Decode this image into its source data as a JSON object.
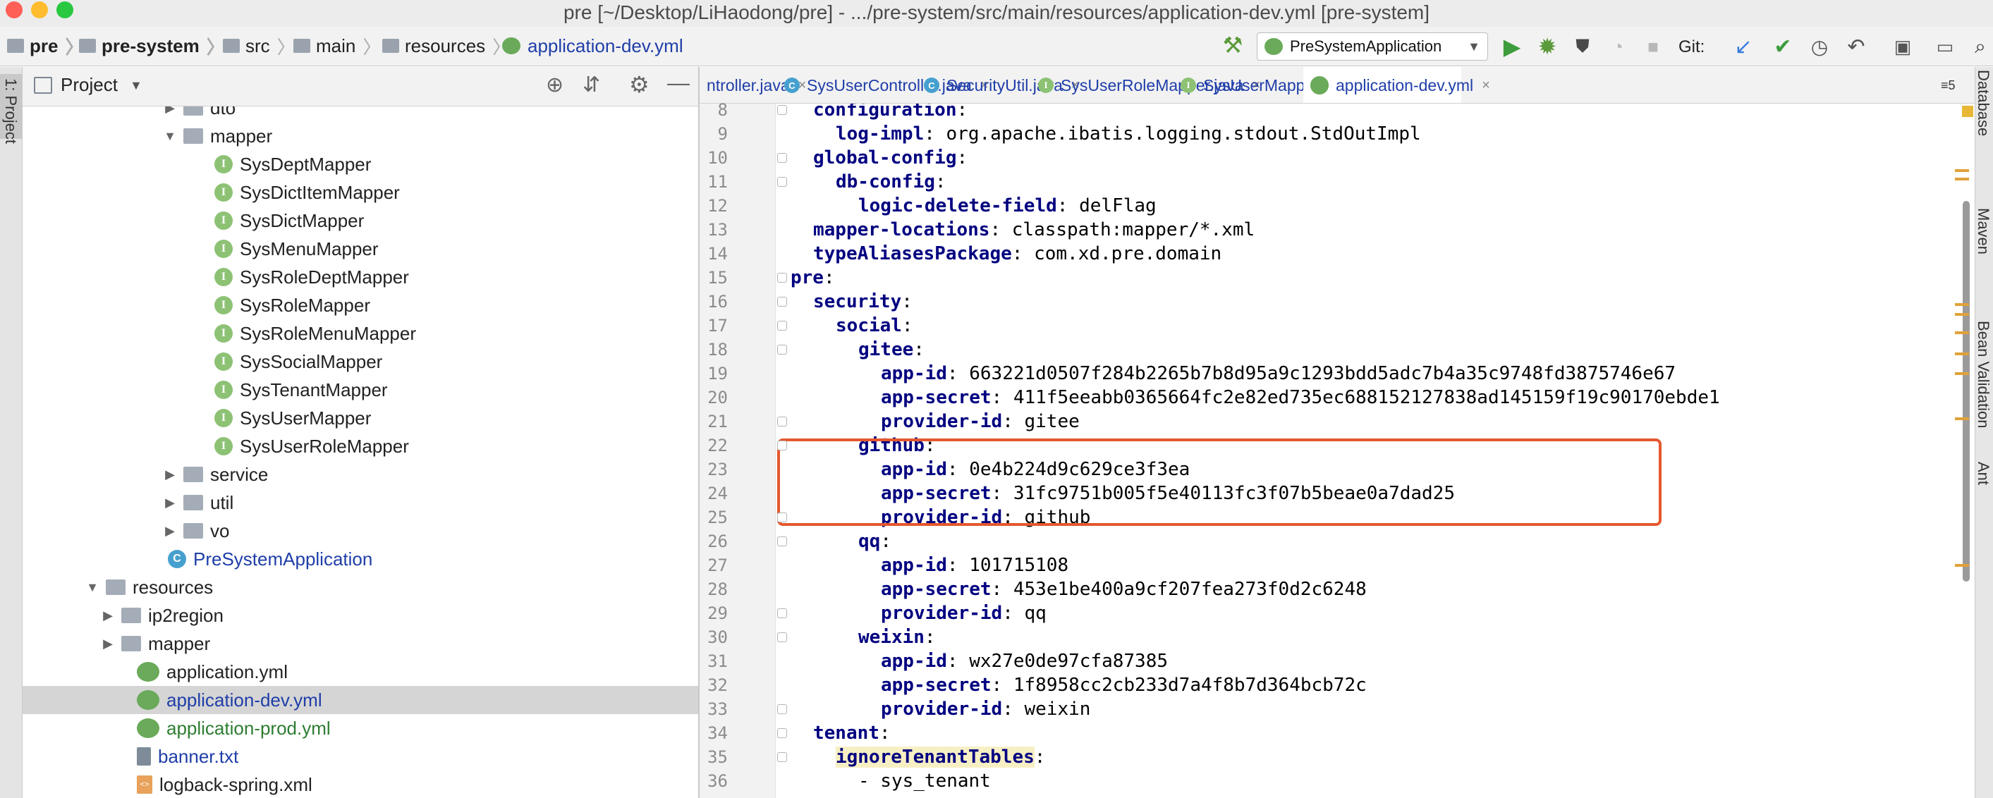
{
  "window": {
    "title": "pre [~/Desktop/LiHaodong/pre] - .../pre-system/src/main/resources/application-dev.yml [pre-system]"
  },
  "navbar": {
    "breadcrumbs": [
      "pre",
      "pre-system",
      "src",
      "main",
      "resources",
      "application-dev.yml"
    ],
    "run_config": "PreSystemApplication",
    "git_label": "Git:"
  },
  "left_strip": {
    "label": "1: Project"
  },
  "right_strip": {
    "labels": [
      "Database",
      "Maven",
      "Bean Validation",
      "Ant"
    ]
  },
  "project_panel": {
    "title": "Project",
    "tree": [
      {
        "label": "dto",
        "type": "folder",
        "depth": 9,
        "arrow": "right",
        "top": 0,
        "partial": true
      },
      {
        "label": "mapper",
        "type": "folder",
        "depth": 9,
        "arrow": "down"
      },
      {
        "label": "SysDeptMapper",
        "type": "interface",
        "depth": 11
      },
      {
        "label": "SysDictItemMapper",
        "type": "interface",
        "depth": 11
      },
      {
        "label": "SysDictMapper",
        "type": "interface",
        "depth": 11
      },
      {
        "label": "SysMenuMapper",
        "type": "interface",
        "depth": 11
      },
      {
        "label": "SysRoleDeptMapper",
        "type": "interface",
        "depth": 11
      },
      {
        "label": "SysRoleMapper",
        "type": "interface",
        "depth": 11
      },
      {
        "label": "SysRoleMenuMapper",
        "type": "interface",
        "depth": 11
      },
      {
        "label": "SysSocialMapper",
        "type": "interface",
        "depth": 11
      },
      {
        "label": "SysTenantMapper",
        "type": "interface",
        "depth": 11
      },
      {
        "label": "SysUserMapper",
        "type": "interface",
        "depth": 11
      },
      {
        "label": "SysUserRoleMapper",
        "type": "interface",
        "depth": 11
      },
      {
        "label": "service",
        "type": "folder",
        "depth": 9,
        "arrow": "right"
      },
      {
        "label": "util",
        "type": "folder",
        "depth": 9,
        "arrow": "right"
      },
      {
        "label": "vo",
        "type": "folder",
        "depth": 9,
        "arrow": "right"
      },
      {
        "label": "PreSystemApplication",
        "type": "class",
        "depth": 8
      },
      {
        "label": "resources",
        "type": "folder",
        "depth": 4,
        "arrow": "down"
      },
      {
        "label": "ip2region",
        "type": "folder",
        "depth": 5,
        "arrow": "right"
      },
      {
        "label": "mapper",
        "type": "folder",
        "depth": 5,
        "arrow": "right"
      },
      {
        "label": "application.yml",
        "type": "yml",
        "depth": 6
      },
      {
        "label": "application-dev.yml",
        "type": "yml",
        "depth": 6,
        "selected": true
      },
      {
        "label": "application-prod.yml",
        "type": "yml",
        "depth": 6
      },
      {
        "label": "banner.txt",
        "type": "txt",
        "depth": 6
      },
      {
        "label": "logback-spring.xml",
        "type": "xml",
        "depth": 6
      }
    ]
  },
  "editor": {
    "tabs": [
      {
        "label": "ntroller.java",
        "icon": "class"
      },
      {
        "label": "SysUserController.java",
        "icon": "class"
      },
      {
        "label": "SecurityUtil.java",
        "icon": "class"
      },
      {
        "label": "SysUserRoleMapper.java",
        "icon": "interface"
      },
      {
        "label": "SysUserMapper.java",
        "icon": "interface"
      },
      {
        "label": "application-dev.yml",
        "icon": "yml",
        "active": true
      }
    ],
    "tab_overflow": "≡5",
    "lines": [
      {
        "n": "8",
        "indent": 1,
        "key": "configuration",
        "sep": ":",
        "val": ""
      },
      {
        "n": "9",
        "indent": 2,
        "key": "log-impl",
        "sep": ": ",
        "val": "org.apache.ibatis.logging.stdout.StdOutImpl"
      },
      {
        "n": "10",
        "indent": 1,
        "key": "global-config",
        "sep": ":",
        "val": ""
      },
      {
        "n": "11",
        "indent": 2,
        "key": "db-config",
        "sep": ":",
        "val": ""
      },
      {
        "n": "12",
        "indent": 3,
        "key": "logic-delete-field",
        "sep": ": ",
        "val": "delFlag"
      },
      {
        "n": "13",
        "indent": 1,
        "key": "mapper-locations",
        "sep": ": ",
        "val": "classpath:mapper/*.xml"
      },
      {
        "n": "14",
        "indent": 1,
        "key": "typeAliasesPackage",
        "sep": ": ",
        "val": "com.xd.pre.domain"
      },
      {
        "n": "15",
        "indent": 0,
        "key": "pre",
        "sep": ":",
        "val": ""
      },
      {
        "n": "16",
        "indent": 1,
        "key": "security",
        "sep": ":",
        "val": ""
      },
      {
        "n": "17",
        "indent": 2,
        "key": "social",
        "sep": ":",
        "val": ""
      },
      {
        "n": "18",
        "indent": 3,
        "key": "gitee",
        "sep": ":",
        "val": ""
      },
      {
        "n": "19",
        "indent": 4,
        "key": "app-id",
        "sep": ": ",
        "val": "663221d0507f284b2265b7b8d95a9c1293bdd5adc7b4a35c9748fd3875746e67"
      },
      {
        "n": "20",
        "indent": 4,
        "key": "app-secret",
        "sep": ": ",
        "val": "411f5eeabb0365664fc2e82ed735ec688152127838ad145159f19c90170ebde1"
      },
      {
        "n": "21",
        "indent": 4,
        "key": "provider-id",
        "sep": ": ",
        "val": "gitee"
      },
      {
        "n": "22",
        "indent": 3,
        "key": "github",
        "sep": ":",
        "val": ""
      },
      {
        "n": "23",
        "indent": 4,
        "key": "app-id",
        "sep": ": ",
        "val": "0e4b224d9c629ce3f3ea"
      },
      {
        "n": "24",
        "indent": 4,
        "key": "app-secret",
        "sep": ": ",
        "val": "31fc9751b005f5e40113fc3f07b5beae0a7dad25"
      },
      {
        "n": "25",
        "indent": 4,
        "key": "provider-id",
        "sep": ": ",
        "val": "github"
      },
      {
        "n": "26",
        "indent": 3,
        "key": "qq",
        "sep": ":",
        "val": ""
      },
      {
        "n": "27",
        "indent": 4,
        "key": "app-id",
        "sep": ": ",
        "val": "101715108"
      },
      {
        "n": "28",
        "indent": 4,
        "key": "app-secret",
        "sep": ": ",
        "val": "453e1be400a9cf207fea273f0d2c6248"
      },
      {
        "n": "29",
        "indent": 4,
        "key": "provider-id",
        "sep": ": ",
        "val": "qq"
      },
      {
        "n": "30",
        "indent": 3,
        "key": "weixin",
        "sep": ":",
        "val": ""
      },
      {
        "n": "31",
        "indent": 4,
        "key": "app-id",
        "sep": ": ",
        "val": "wx27e0de97cfa87385"
      },
      {
        "n": "32",
        "indent": 4,
        "key": "app-secret",
        "sep": ": ",
        "val": "1f8958cc2cb233d7a4f8b7d364bcb72c"
      },
      {
        "n": "33",
        "indent": 4,
        "key": "provider-id",
        "sep": ": ",
        "val": "weixin"
      },
      {
        "n": "34",
        "indent": 1,
        "key": "tenant",
        "sep": ":",
        "val": ""
      },
      {
        "n": "35",
        "indent": 2,
        "key": "ignoreTenantTables",
        "sep": ":",
        "val": "",
        "highlight": true
      },
      {
        "n": "36",
        "indent": 3,
        "key": "",
        "sep": "",
        "val": "- sys_tenant"
      }
    ]
  },
  "colors": {
    "key": "#000080",
    "highlight_box": "#e4582d",
    "accent": "#4a86e8"
  }
}
